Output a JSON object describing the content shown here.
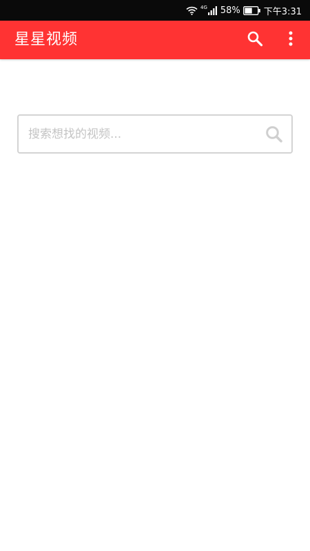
{
  "status_bar": {
    "network": "4G",
    "battery_percent": "58%",
    "time": "下午3:31",
    "battery_level": 0.58
  },
  "app_bar": {
    "title": "星星视频",
    "background_color": "#ff3333",
    "actions": [
      {
        "icon": "search-icon"
      },
      {
        "icon": "more-vert-icon"
      }
    ]
  },
  "search": {
    "placeholder": "搜索想找的视频...",
    "value": "",
    "icon": "search-icon"
  }
}
